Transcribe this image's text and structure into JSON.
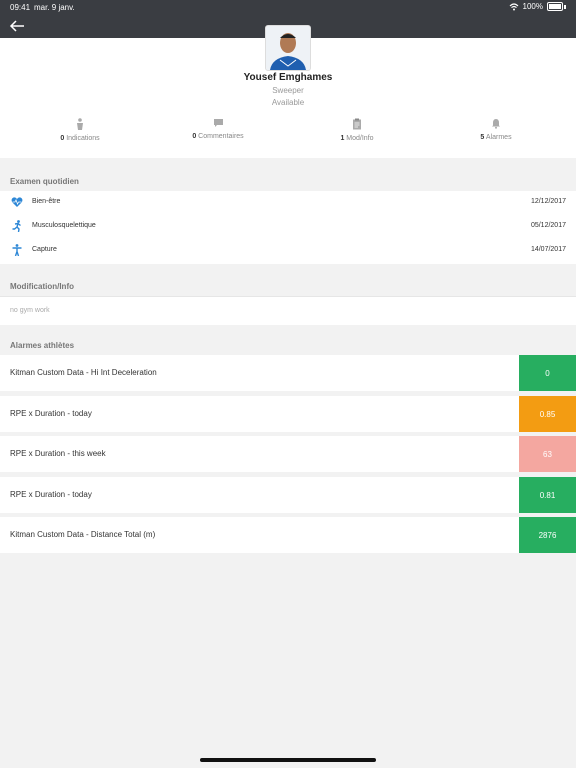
{
  "status": {
    "time": "09:41",
    "date": "mar. 9 janv.",
    "battery": "100%"
  },
  "profile": {
    "name": "Yousef Emghames",
    "role": "Sweeper",
    "availability": "Available"
  },
  "stats": [
    {
      "count": "0",
      "label": "Indications",
      "icon": "person-icon"
    },
    {
      "count": "0",
      "label": "Commentaires",
      "icon": "comment-icon"
    },
    {
      "count": "1",
      "label": "Mod/Info",
      "icon": "clipboard-icon"
    },
    {
      "count": "5",
      "label": "Alarmes",
      "icon": "bell-icon"
    }
  ],
  "daily": {
    "title": "Examen quotidien",
    "rows": [
      {
        "label": "Bien-être",
        "date": "12/12/2017",
        "icon": "heart-pulse-icon"
      },
      {
        "label": "Musculosquelettique",
        "date": "05/12/2017",
        "icon": "running-icon"
      },
      {
        "label": "Capture",
        "date": "14/07/2017",
        "icon": "person-standing-icon"
      }
    ]
  },
  "modification": {
    "title": "Modification/Info",
    "text": "no gym work"
  },
  "alarms": {
    "title": "Alarmes athlètes",
    "items": [
      {
        "label": "Kitman Custom Data - Hi Int Deceleration",
        "value": "0",
        "color": "#27ae60"
      },
      {
        "label": "RPE x Duration - today",
        "value": "0.85",
        "color": "#f39c12"
      },
      {
        "label": "RPE x Duration - this week",
        "value": "63",
        "color": "#f4a7a0"
      },
      {
        "label": "RPE x Duration - today",
        "value": "0.81",
        "color": "#27ae60"
      },
      {
        "label": "Kitman Custom Data - Distance Total (m)",
        "value": "2876",
        "color": "#27ae60"
      }
    ]
  },
  "colors": {
    "topbar": "#3a3d42",
    "accent": "#2d87d6"
  }
}
